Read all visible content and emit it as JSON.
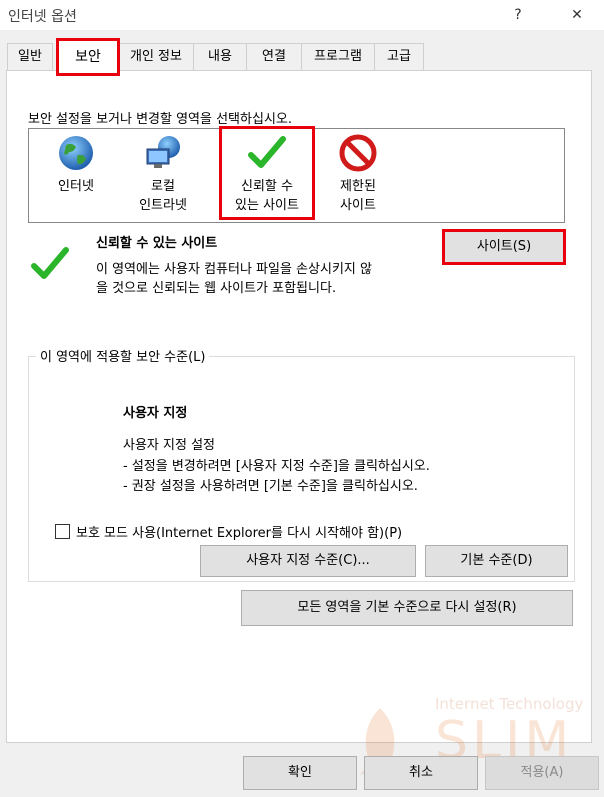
{
  "window": {
    "title": "인터넷 옵션",
    "help_icon": "?",
    "close_icon": "✕"
  },
  "tabs": [
    {
      "label": "일반",
      "active": false
    },
    {
      "label": "보안",
      "active": true
    },
    {
      "label": "개인 정보",
      "active": false
    },
    {
      "label": "내용",
      "active": false
    },
    {
      "label": "연결",
      "active": false
    },
    {
      "label": "프로그램",
      "active": false
    },
    {
      "label": "고급",
      "active": false
    }
  ],
  "security": {
    "instruction": "보안 설정을 보거나 변경할 영역을 선택하십시오.",
    "zones": [
      {
        "line1": "인터넷",
        "line2": "",
        "icon": "globe-icon"
      },
      {
        "line1": "로컬",
        "line2": "인트라넷",
        "icon": "intranet-icon"
      },
      {
        "line1": "신뢰할 수",
        "line2": "있는 사이트",
        "icon": "checkmark-icon",
        "selected": true
      },
      {
        "line1": "제한된",
        "line2": "사이트",
        "icon": "restricted-icon"
      }
    ],
    "selected_title": "신뢰할 수 있는 사이트",
    "selected_desc_line1": "이 영역에는 사용자 컴퓨터나 파일을 손상시키지 않",
    "selected_desc_line2": "을 것으로 신뢰되는 웹 사이트가 포함됩니다.",
    "sites_button": "사이트(S)"
  },
  "level_group": {
    "legend": "이 영역에 적용할 보안 수준(L)",
    "level_title": "사용자 지정",
    "level_desc_1": "사용자 지정 설정",
    "level_desc_2": "- 설정을 변경하려면 [사용자 지정 수준]을 클릭하십시오.",
    "level_desc_3": "- 권장 설정을 사용하려면 [기본 수준]을 클릭하십시오.",
    "protected_mode_label": "보호 모드 사용(Internet Explorer를 다시 시작해야 함)(P)",
    "protected_mode_checked": false,
    "custom_level_button": "사용자 지정 수준(C)...",
    "default_level_button": "기본 수준(D)"
  },
  "reset_all_button": "모든 영역을 기본 수준으로 다시 설정(R)",
  "footer": {
    "ok": "확인",
    "cancel": "취소",
    "apply": "적용(A)"
  },
  "watermark": {
    "line1": "Internet Technology",
    "line2": "SLIM"
  },
  "colors": {
    "highlight": "#e8000d",
    "check_green": "#2bb52b",
    "restricted_red": "#d11a1a"
  }
}
